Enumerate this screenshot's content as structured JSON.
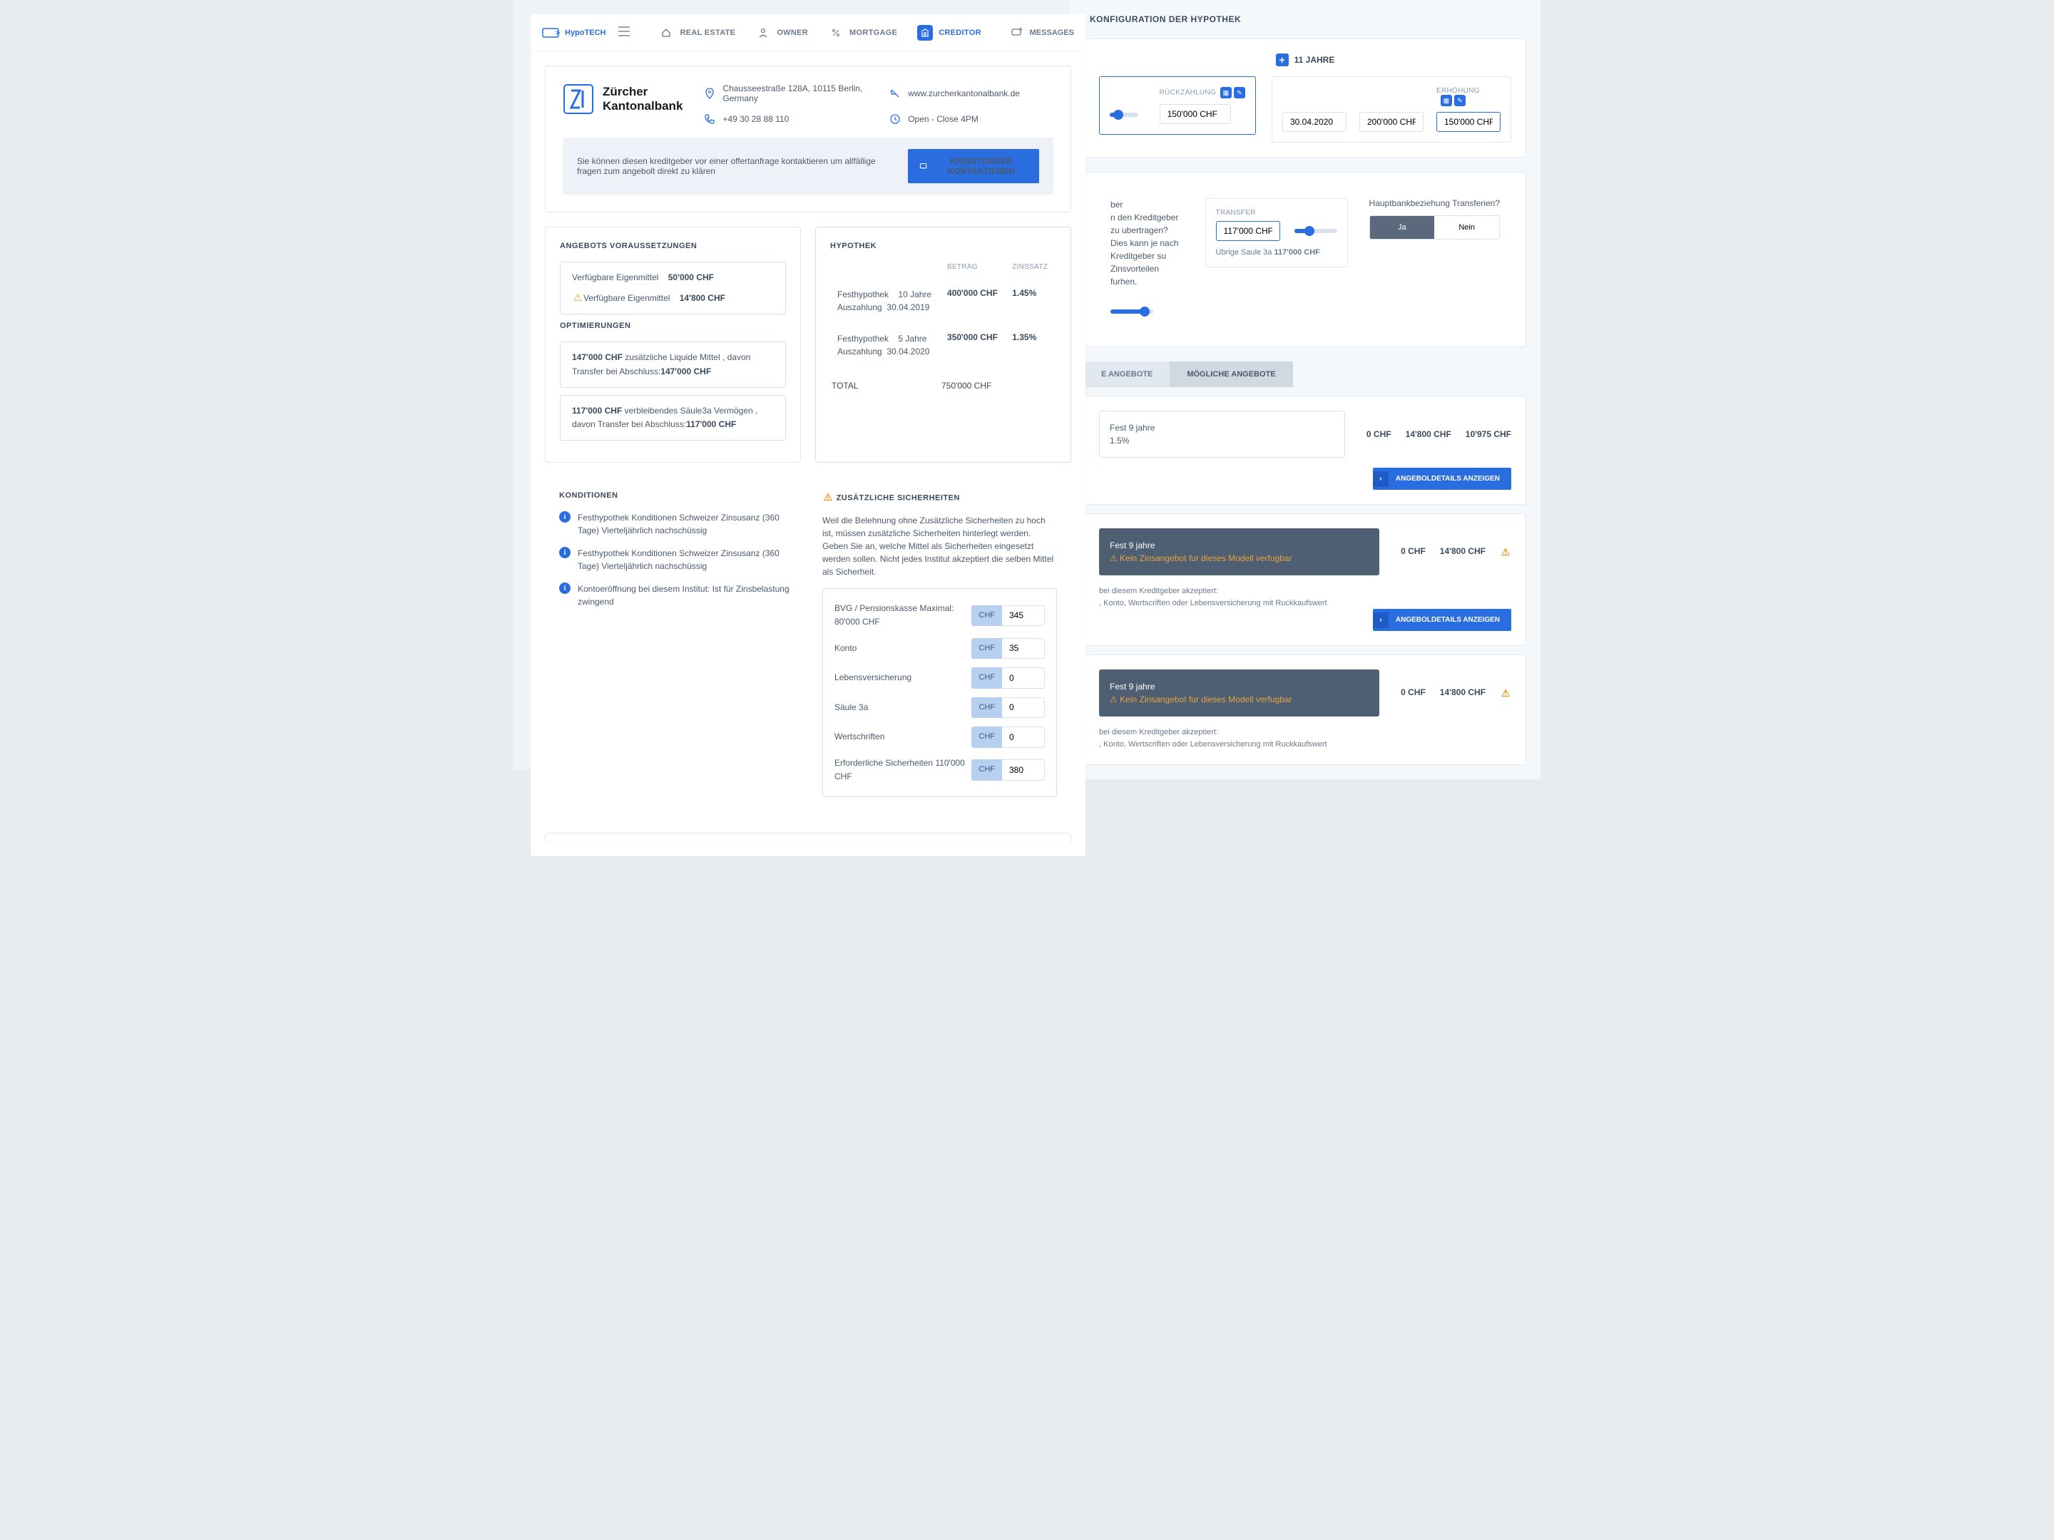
{
  "app": {
    "logo": "HypoTECH"
  },
  "nav": {
    "items": [
      {
        "label": "REAL ESTATE"
      },
      {
        "label": "OWNER"
      },
      {
        "label": "MORTGAGE"
      },
      {
        "label": "CREDITOR"
      }
    ],
    "messages": "MESSAGES"
  },
  "bank": {
    "name": "Zürcher\nKantonalbank",
    "address": "Chausseestraße 128A, 10115 Berlin, Germany",
    "website": "www.zurcherkantonalbank.de",
    "phone": "+49 30 28 88 110",
    "hours": "Open - Close 4PM",
    "contact_text": "Sie können diesen kreditgeber vor einer offertanfrage kontaktieren um allfällige fragen zum angebolt direkt zu klären",
    "contact_btn": "KREDITGEBER KONTAKTIEREN"
  },
  "prereq": {
    "title": "ANGEBOTS VORAUSSETZUNGEN",
    "l1": "Verfügbare Eigenmittel",
    "v1": "50'000 CHF",
    "l2": "Verfügbare Eigenmittel",
    "v2": "14'800 CHF"
  },
  "opt": {
    "title": "OPTIMIERUNGEN",
    "a1": "147'000 CHF",
    "t1": "zusätzliche Liquide Mittel , davon Transfer bei Abschluss:",
    "s1": "147'000 CHF",
    "a2": "117'000 CHF",
    "t2": "verbleibendes Säule3a Vermögen       , davon Transfer bei Abschluss:",
    "s2": "117'000 CHF"
  },
  "hyp": {
    "title": "HYPOTHEK",
    "h1": "BETRAG",
    "h2": "ZINSSATZ",
    "r1a": "Festhypothek",
    "r1b": "10 Jahre",
    "r1c": "Auszahlung",
    "r1d": "30.04.2019",
    "r1e": "400'000 CHF",
    "r1f": "1.45%",
    "r2a": "Festhypothek",
    "r2b": "5 Jahre",
    "r2c": "Auszahlung",
    "r2d": "30.04.2020",
    "r2e": "350'000 CHF",
    "r2f": "1.35%",
    "tot": "TOTAL",
    "totv": "750'000 CHF"
  },
  "kond": {
    "title": "KONDITIONEN",
    "i1": "Festhypothek Konditionen Schweizer Zinsusanz (360 Tage) Vierteljährlich nachschüssig",
    "i2": "Festhypothek Konditionen Schweizer Zinsusanz (360 Tage) Vierteljährlich nachschüssig",
    "i3": "Kontoeröffnung bei diesem Institut: Ist für Zinsbelastung zwingend"
  },
  "sec": {
    "title": "ZUSÄTZLICHE SICHERHEITEN",
    "desc": "Weil die Belehnung ohne Zusätzliche Sicherheiten zu hoch ist, müssen zusätzliche Sicherheiten hinterlegt werden. Geben Sie an, welche Mittel als Sicherheiten eingesetzt werden sollen. Nicht jedes Institut akzeptiert die selben Mittel als Sicherheit.",
    "unit": "CHF",
    "rows": [
      {
        "l": "BVG / Pensionskasse Maximal: 80'000 CHF",
        "v": "345"
      },
      {
        "l": "Konto",
        "v": "35"
      },
      {
        "l": "Lebensversicherung",
        "v": "0"
      },
      {
        "l": "Säule 3a",
        "v": "0"
      },
      {
        "l": "Wertschriften",
        "v": "0"
      },
      {
        "l": "Erforderliche Sicherheiten 110'000 CHF",
        "v": "380"
      }
    ]
  },
  "cfg": {
    "title": "KONFIGURATION DER HYPOTHEK",
    "years": "11 JAHRE",
    "ruck": "RÜCKZAHLUNG",
    "ruckv": "150'000 CHF",
    "date": "30.04.2020",
    "amt": "200'000 CHF",
    "erh": "ERHÖHUNG",
    "erhv": "150'000 CHF"
  },
  "trf": {
    "t1": "ber",
    "t2": "n den Kreditgeber zu ubertragen? Dies kann je nach Kreditgeber su Zinsvorteilen furhen.",
    "label": "TRANSFER",
    "val": "117'000 CHF",
    "sub": "Ubrige Saule 3a",
    "subv": "117'000 CHF",
    "q": "Hauptbankbeziehung Transferien?",
    "yes": "Ja",
    "no": "Nein"
  },
  "tabs": {
    "a": "E ANGEBOTE",
    "b": "MÖGLICHE ANGEBOTE"
  },
  "offers": [
    {
      "dark": false,
      "l1": "Fest 9 jahre",
      "l2": "1.5%",
      "v1": "0 CHF",
      "v2": "14'800 CHF",
      "v3": "10'975 CHF",
      "btn": "ANGEBOLDETAILS ANZEIGEN"
    },
    {
      "dark": true,
      "l1": "Fest 9 jahre",
      "l2": "Kein Zinsangebot fur dieses Modell verfugbar",
      "v1": "0 CHF",
      "v2": "14'800 CHF",
      "btn": "ANGEBOLDETAILS ANZEIGEN",
      "note1": "bei diesem Kreditgeber akzeptiert:",
      "note2": ", Konto, Wertscriften oder Lebensversicherung mit Ruckkaufswert"
    },
    {
      "dark": true,
      "l1": "Fest 9 jahre",
      "l2": "Kein Zinsangebot fur dieses Modell verfugbar",
      "v1": "0 CHF",
      "v2": "14'800 CHF",
      "note1": "bei diesem Kreditgeber akzeptiert:",
      "note2": ", Konto, Wertscriften oder Lebensversicherung mit Ruckkaufswert"
    }
  ]
}
